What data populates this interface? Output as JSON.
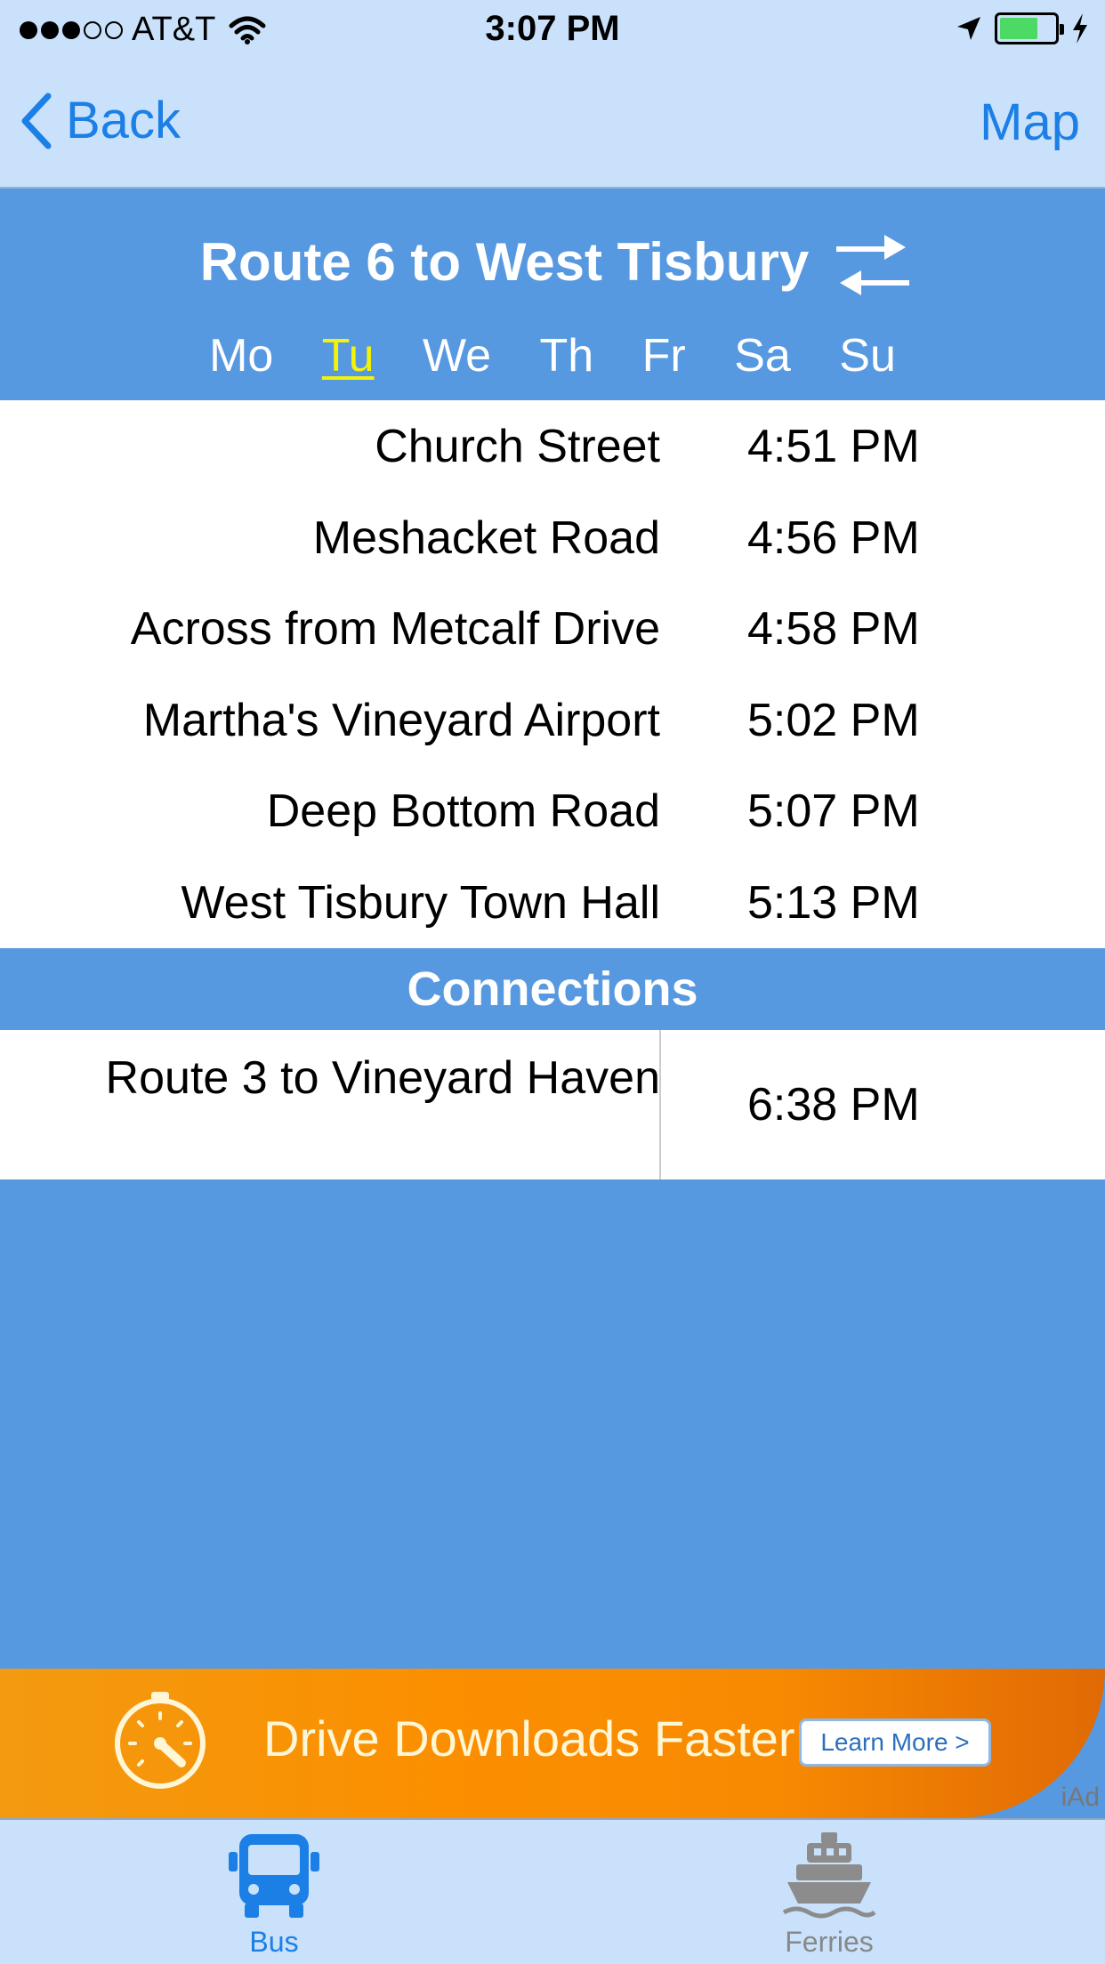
{
  "status_bar": {
    "carrier": "AT&T",
    "time": "3:07 PM",
    "signal_bars_filled": 3,
    "signal_bars_total": 5,
    "battery_level": 0.7
  },
  "nav": {
    "back_label": "Back",
    "map_label": "Map"
  },
  "route": {
    "title": "Route 6 to West Tisbury",
    "days": [
      "Mo",
      "Tu",
      "We",
      "Th",
      "Fr",
      "Sa",
      "Su"
    ],
    "selected_day": "Tu"
  },
  "stops": [
    {
      "name": "Church Street",
      "time": "4:51 PM"
    },
    {
      "name": "Meshacket Road",
      "time": "4:56 PM"
    },
    {
      "name": "Across from Metcalf Drive",
      "time": "4:58 PM"
    },
    {
      "name": "Martha's Vineyard Airport",
      "time": "5:02 PM"
    },
    {
      "name": "Deep Bottom Road",
      "time": "5:07 PM"
    },
    {
      "name": "West Tisbury Town Hall",
      "time": "5:13 PM"
    }
  ],
  "connections": {
    "header": "Connections",
    "items": [
      {
        "name": "Route 3 to Vineyard Haven",
        "time": "6:38 PM"
      }
    ]
  },
  "ad": {
    "text": "Drive Downloads Faster",
    "button_label": "Learn More >",
    "badge": "iAd"
  },
  "tabs": [
    {
      "label": "Bus",
      "icon": "bus-icon",
      "active": true
    },
    {
      "label": "Ferries",
      "icon": "ferry-icon",
      "active": false
    }
  ],
  "colors": {
    "accent": "#1C7FE6",
    "header_blue": "#5799E0",
    "bar_background": "#C9E1FA",
    "selected_day": "#F2F20A",
    "ad_orange": "#F88A02"
  }
}
